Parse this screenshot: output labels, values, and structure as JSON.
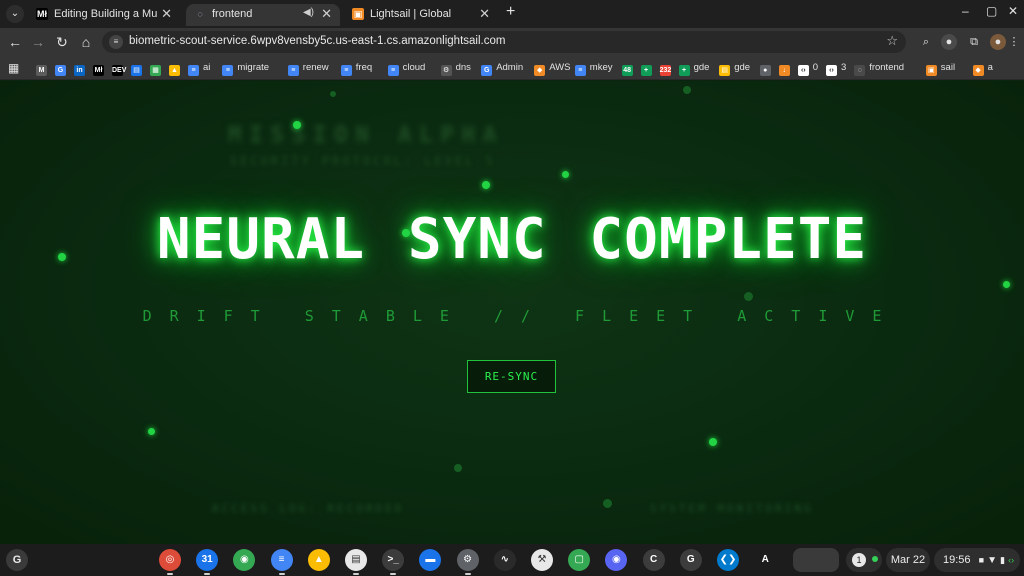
{
  "browser": {
    "tabs": [
      {
        "title": "Editing Building a Multimodal L",
        "favicon": "Mł"
      },
      {
        "title": "frontend",
        "favicon": "◌"
      },
      {
        "title": "Lightsail | Global",
        "favicon": "▣"
      }
    ],
    "url": "biometric-scout-service.6wpv8vensby5c.us-east-1.cs.amazonlightsail.com"
  },
  "bookmarks": [
    {
      "label": "",
      "icon": "M",
      "color": "#5c5c5c"
    },
    {
      "label": "",
      "icon": "G",
      "color": "#4285f4"
    },
    {
      "label": "",
      "icon": "in",
      "color": "#0a66c2"
    },
    {
      "label": "",
      "icon": "Mł",
      "color": "#000000"
    },
    {
      "label": "",
      "icon": "DEV",
      "color": "#000000"
    },
    {
      "label": "",
      "icon": "▤",
      "color": "#1a73e8"
    },
    {
      "label": "",
      "icon": "▦",
      "color": "#34a853"
    },
    {
      "label": "",
      "icon": "▲",
      "color": "#fbbc04"
    },
    {
      "label": "ai",
      "icon": "≡",
      "color": "#4285f4"
    },
    {
      "label": "migrate",
      "icon": "≡",
      "color": "#4285f4"
    },
    {
      "label": "renew",
      "icon": "≡",
      "color": "#4285f4"
    },
    {
      "label": "freq",
      "icon": "≡",
      "color": "#4285f4"
    },
    {
      "label": "cloud",
      "icon": "≡",
      "color": "#4285f4"
    },
    {
      "label": "dns",
      "icon": "⚙",
      "color": "#555555"
    },
    {
      "label": "Admin",
      "icon": "G",
      "color": "#4285f4"
    },
    {
      "label": "AWS",
      "icon": "◆",
      "color": "#f08a24"
    },
    {
      "label": "mkey",
      "icon": "≡",
      "color": "#4285f4"
    },
    {
      "label": "",
      "icon": "48",
      "color": "#0f9d58"
    },
    {
      "label": "",
      "icon": "+",
      "color": "#0f9d58"
    },
    {
      "label": "",
      "icon": "232",
      "color": "#ea4335"
    },
    {
      "label": "gde",
      "icon": "+",
      "color": "#0f9d58"
    },
    {
      "label": "gde",
      "icon": "▤",
      "color": "#fbbc04"
    },
    {
      "label": "",
      "icon": "●",
      "color": "#5f6368"
    },
    {
      "label": "",
      "icon": "↓",
      "color": "#f08a24"
    },
    {
      "label": "0",
      "icon": "‹›",
      "color": "#ffffff"
    },
    {
      "label": "3",
      "icon": "‹›",
      "color": "#ffffff"
    },
    {
      "label": "frontend",
      "icon": "◌",
      "color": "#4a4a4a"
    },
    {
      "label": "sail",
      "icon": "▣",
      "color": "#f08a24"
    },
    {
      "label": "a",
      "icon": "◆",
      "color": "#f08a24"
    }
  ],
  "page": {
    "ghost_title": "MISSION ALPHA",
    "ghost_subtitle": "SECURITY PROTOCOL: LEVEL 5",
    "ghost_footer_left": "ACCESS LOG: RECORDED",
    "ghost_footer_right": "SYSTEM MONITORING",
    "headline": "NEURAL SYNC COMPLETE",
    "subline": "DRIFT STABLE // FLEET ACTIVE",
    "button_label": "RE-SYNC",
    "accent_color": "#22d444"
  },
  "shelf": {
    "launcher_label": "G",
    "apps": [
      {
        "name": "chrome",
        "glyph": "◎",
        "color": "#dd4b39"
      },
      {
        "name": "calendar",
        "glyph": "31",
        "color": "#1a73e8"
      },
      {
        "name": "maps",
        "glyph": "◉",
        "color": "#34a853"
      },
      {
        "name": "docs",
        "glyph": "≡",
        "color": "#4285f4"
      },
      {
        "name": "drive",
        "glyph": "▲",
        "color": "#fbbc04"
      },
      {
        "name": "slides",
        "glyph": "▤",
        "color": "#e8e8e8"
      },
      {
        "name": "terminal",
        "glyph": ">_",
        "color": "#3c3c3c"
      },
      {
        "name": "files",
        "glyph": "▬",
        "color": "#1a73e8"
      },
      {
        "name": "settings",
        "glyph": "⚙",
        "color": "#5f6368"
      },
      {
        "name": "activity",
        "glyph": "∿",
        "color": "#2a2a2a"
      },
      {
        "name": "tools",
        "glyph": "⚒",
        "color": "#e8e8e8"
      },
      {
        "name": "chat",
        "glyph": "▢",
        "color": "#34a853"
      },
      {
        "name": "discord",
        "glyph": "◉",
        "color": "#5865f2"
      },
      {
        "name": "c-app",
        "glyph": "C",
        "color": "#3c3c3c"
      },
      {
        "name": "g-app",
        "glyph": "G",
        "color": "#3c3c3c"
      },
      {
        "name": "vscode",
        "glyph": "❮❯",
        "color": "#007acc"
      },
      {
        "name": "a-app",
        "glyph": "A",
        "color": "#1c1c1c"
      }
    ],
    "notification_count": "1",
    "date": "Mar 22",
    "time": "19:56"
  }
}
